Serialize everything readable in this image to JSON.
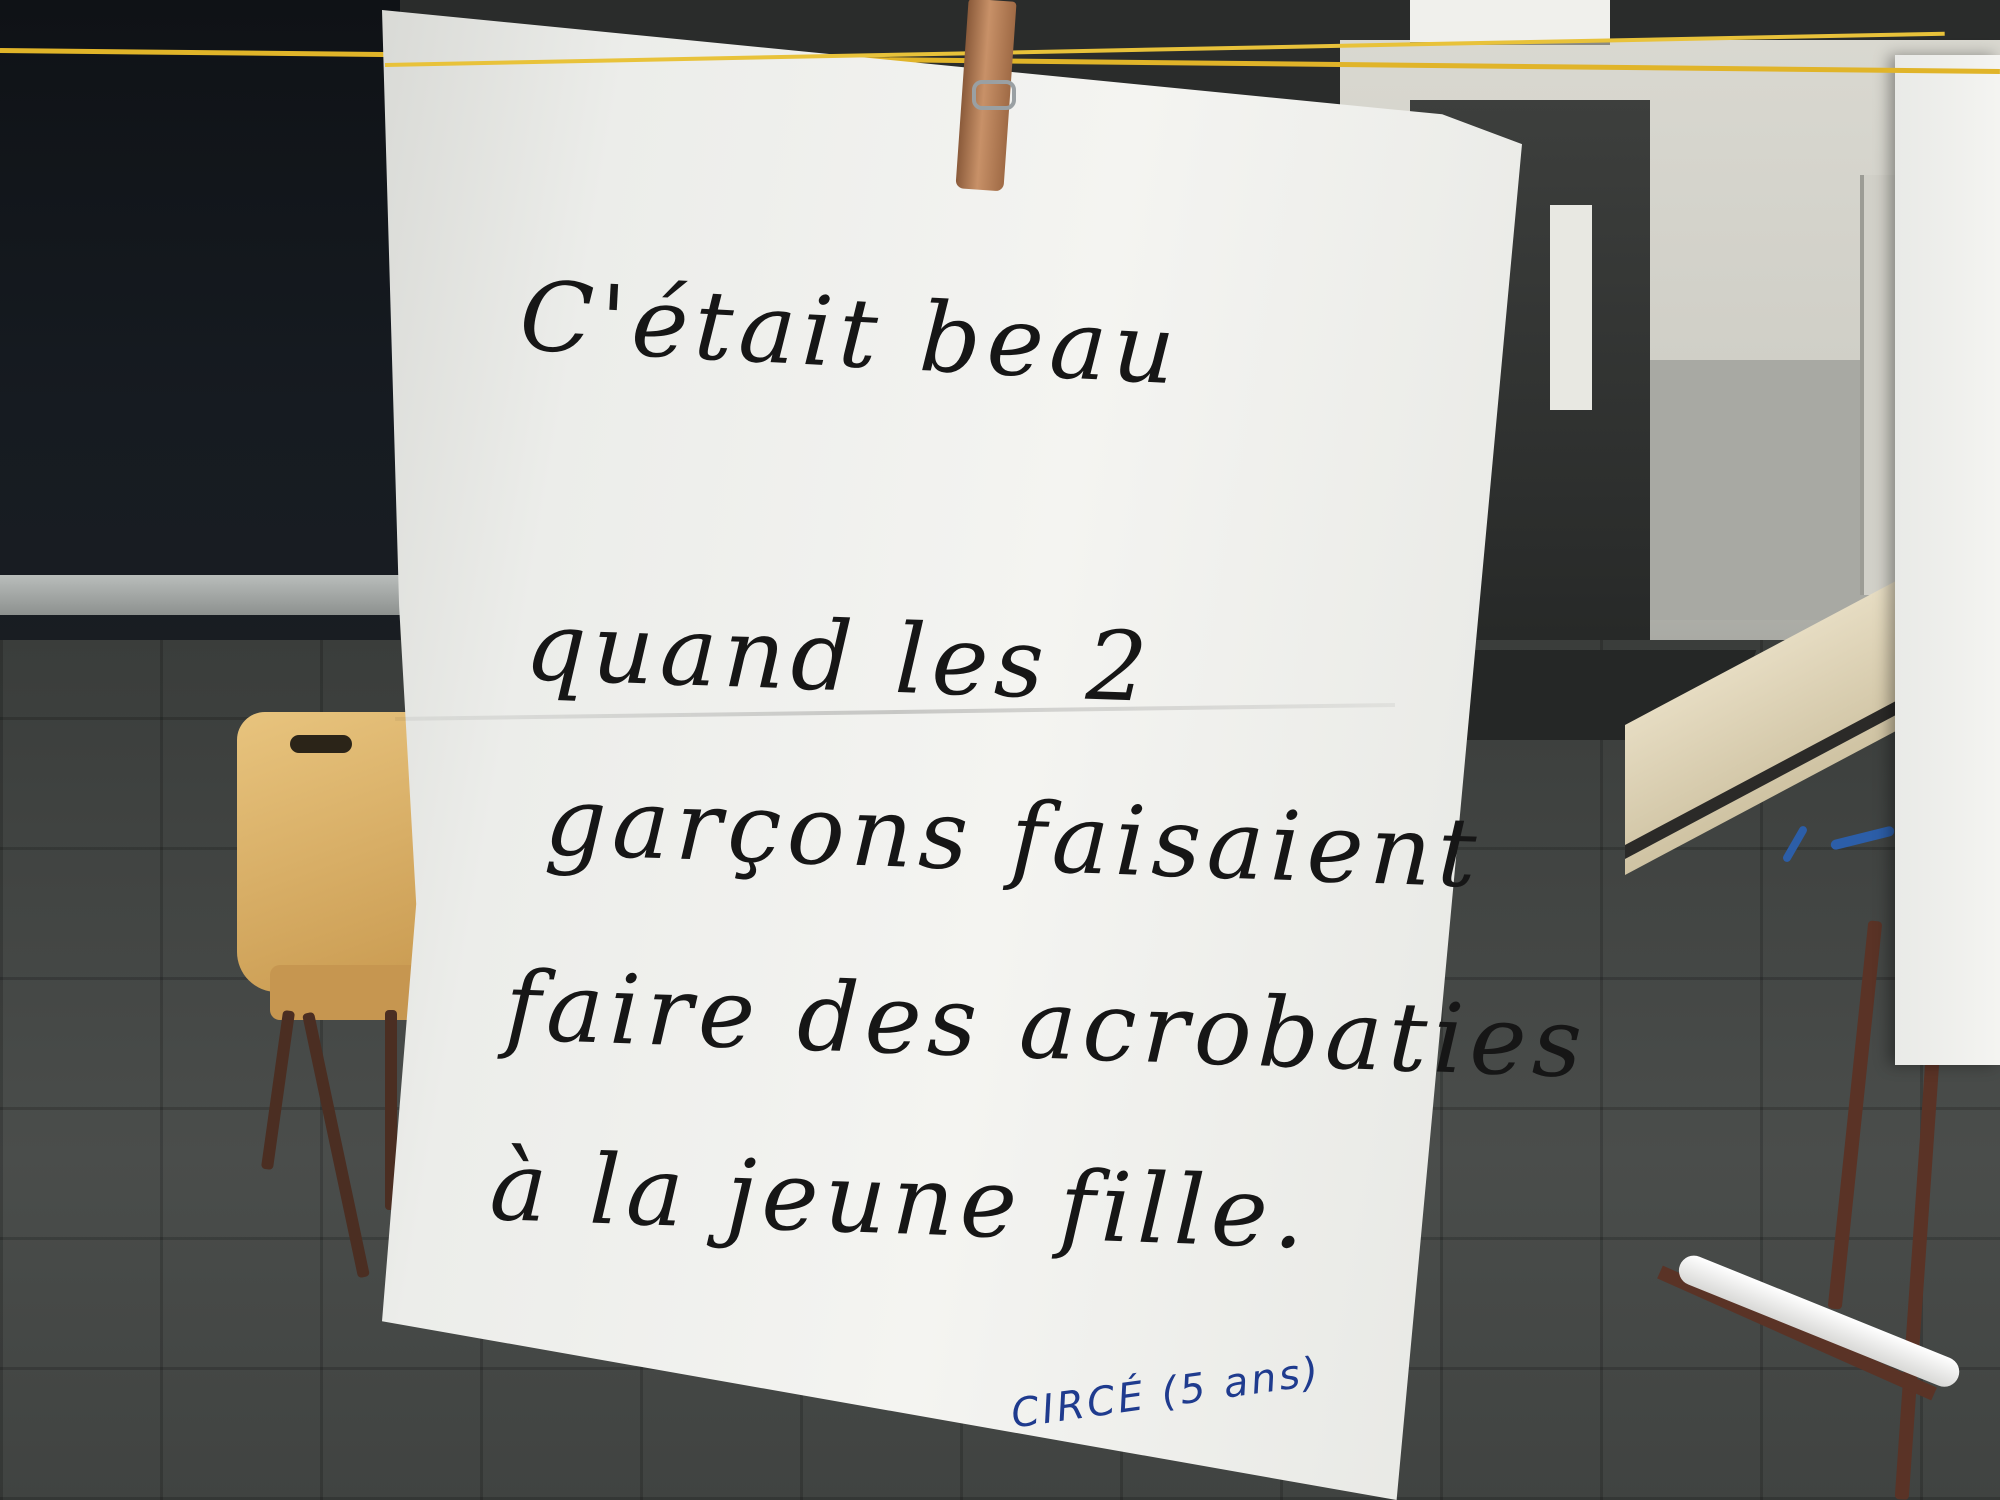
{
  "sign": {
    "lines": [
      "C'était beau",
      "quand les 2",
      "garçons faisaient",
      "faire des acrobaties",
      "à la jeune fille."
    ],
    "signature": "CIRCÉ (5 ans)"
  },
  "colors": {
    "ink": "#161616",
    "signature_ink": "#1f3b8e",
    "paper": "#f4f4f1",
    "line": "#e0b429",
    "pin": "#c89168"
  }
}
